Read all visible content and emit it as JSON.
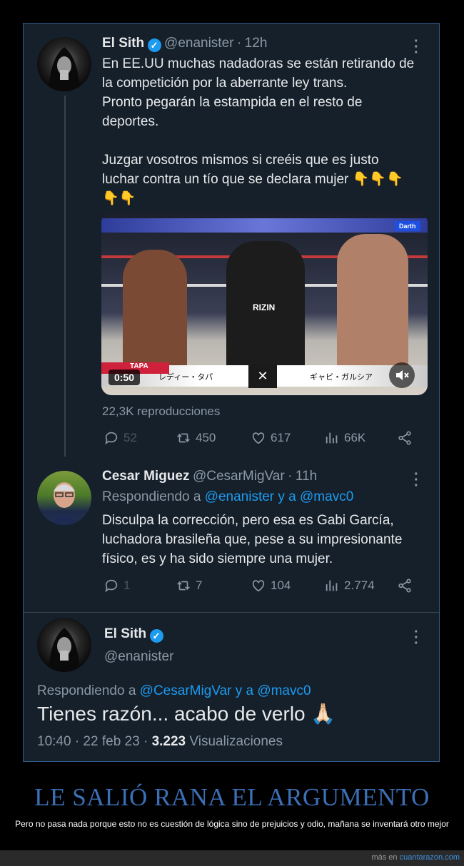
{
  "tweet1": {
    "name": "El Sith",
    "handle": "@enanister",
    "time": "12h",
    "text": "En EE.UU muchas nadadoras se están retirando de\nla competición por la aberrante ley trans.\nPronto pegarán la estampida en el resto de\ndeportes.\n\nJuzgar vosotros mismos si creéis que es justo\nluchar contra un tío que se declara mujer 👇👇👇\n👇👇",
    "video": {
      "duration": "0:50",
      "badge": "Darth",
      "left_fighter": "レディー・タパ",
      "right_fighter": "ギャビ・ガルシア",
      "banner": "RIZIN",
      "left_tag": "TAPA"
    },
    "views": "22,3K reproducciones",
    "actions": {
      "replies": "52",
      "retweets": "450",
      "likes": "617",
      "views": "66K"
    }
  },
  "tweet2": {
    "name": "Cesar Miguez",
    "handle": "@CesarMigVar",
    "time": "11h",
    "replying_prefix": "Respondiendo a",
    "replying_users": "@enanister y a @mavc0",
    "text": "Disculpa la corrección, pero esa es Gabi García,\nluchadora brasileña que, pese a su impresionante\nfísico, es y ha sido siempre una mujer.",
    "actions": {
      "replies": "1",
      "retweets": "7",
      "likes": "104",
      "views": "2.774"
    }
  },
  "tweet3": {
    "name": "El Sith",
    "handle": "@enanister",
    "replying_prefix": "Respondiendo a",
    "replying_users": "@CesarMigVar y a @mavc0",
    "text": "Tienes razón... acabo de verlo 🙏🏻",
    "timestamp": "10:40 · 22 feb 23 · ",
    "view_count": "3.223",
    "view_label": " Visualizaciones"
  },
  "caption": {
    "title": "LE SALIÓ RANA EL ARGUMENTO",
    "subtitle": "Pero no pasa nada porque esto no es cuestión de lógica sino de prejuicios y odio, mañana se inventará otro mejor",
    "footer_prefix": "más en ",
    "footer_link": "cuantarazon.com"
  },
  "colors": {
    "background": "#000000",
    "tweet_bg": "#15202b",
    "accent": "#1d9bf0",
    "caption_title": "#3b6fb6"
  }
}
